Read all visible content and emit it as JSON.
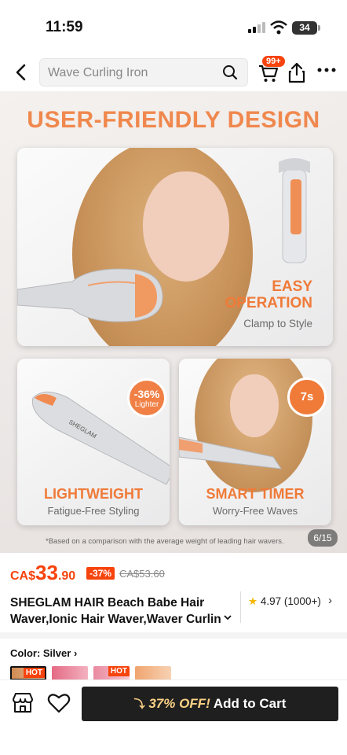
{
  "status_bar": {
    "time": "11:59",
    "battery": "34"
  },
  "nav": {
    "search_placeholder": "Wave Curling Iron",
    "cart_badge": "99+"
  },
  "banner": {
    "title": "USER-FRIENDLY DESIGN",
    "main_card": {
      "heading_line1": "EASY",
      "heading_line2": "OPERATION",
      "subtitle": "Clamp to Style"
    },
    "left_card": {
      "badge_value": "-36%",
      "badge_label": "Lighter",
      "heading": "LIGHTWEIGHT",
      "subtitle": "Fatigue-Free Styling"
    },
    "right_card": {
      "badge_value": "7s",
      "heading": "SMART TIMER",
      "subtitle": "Worry-Free Waves"
    },
    "footnote": "*Based on a comparison with the average weight of leading hair wavers.",
    "page_indicator": "6/15"
  },
  "price": {
    "currency": "CA$",
    "integer": "33",
    "decimal": ".90",
    "discount": "-37%",
    "original": "CA$53.60"
  },
  "product": {
    "title": "SHEGLAM HAIR Beach Babe Hair Waver,Ionic Hair Waver,Waver Curlin",
    "rating": "4.97",
    "rating_count": "(1000+)"
  },
  "color": {
    "label": "Color: ",
    "value": "Silver",
    "hot_label": "HOT"
  },
  "cta": {
    "off_text": "37% OFF!",
    "label": "Add to Cart"
  },
  "colors": {
    "accent": "#f7430c",
    "banner_orange": "#f07a38",
    "cta_bg": "#1f1f1f"
  }
}
